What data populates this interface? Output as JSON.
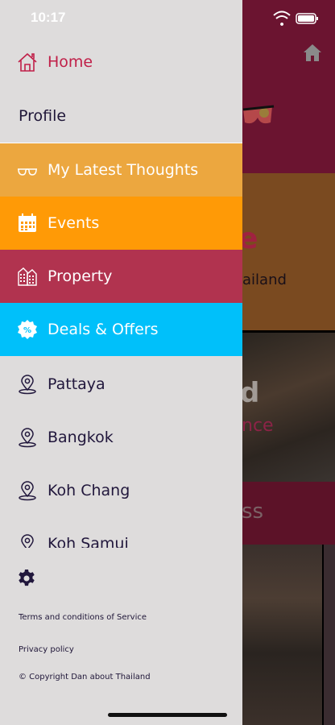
{
  "status_bar": {
    "time": "10:17"
  },
  "drawer": {
    "items": [
      {
        "label": "Home",
        "icon": "home-icon"
      },
      {
        "label": "Profile"
      },
      {
        "label": "My Latest Thoughts",
        "icon": "glasses-icon",
        "color": "#eca73f"
      },
      {
        "label": "Events",
        "icon": "calendar-icon",
        "color": "#ff9a06"
      },
      {
        "label": "Property",
        "icon": "building-icon",
        "color": "#b1334f"
      },
      {
        "label": "Deals & Offers",
        "icon": "percent-badge-icon",
        "color": "#00c0fa"
      },
      {
        "label": "Pattaya",
        "icon": "location-pin-icon"
      },
      {
        "label": "Bangkok",
        "icon": "location-pin-icon"
      },
      {
        "label": "Koh Chang",
        "icon": "location-pin-icon"
      },
      {
        "label": "Koh Samui",
        "icon": "location-pin-icon"
      }
    ],
    "settings_icon": "gear-icon",
    "footer": {
      "terms": "Terms and conditions of Service",
      "privacy": "Privacy policy",
      "copyright": "© Copyright Dan about Thailand"
    }
  },
  "background": {
    "partial_letter_1": "e",
    "partial_text_1": "ailand",
    "partial_letter_2": "d",
    "partial_text_2": "nce",
    "partial_text_3": "ss"
  }
}
